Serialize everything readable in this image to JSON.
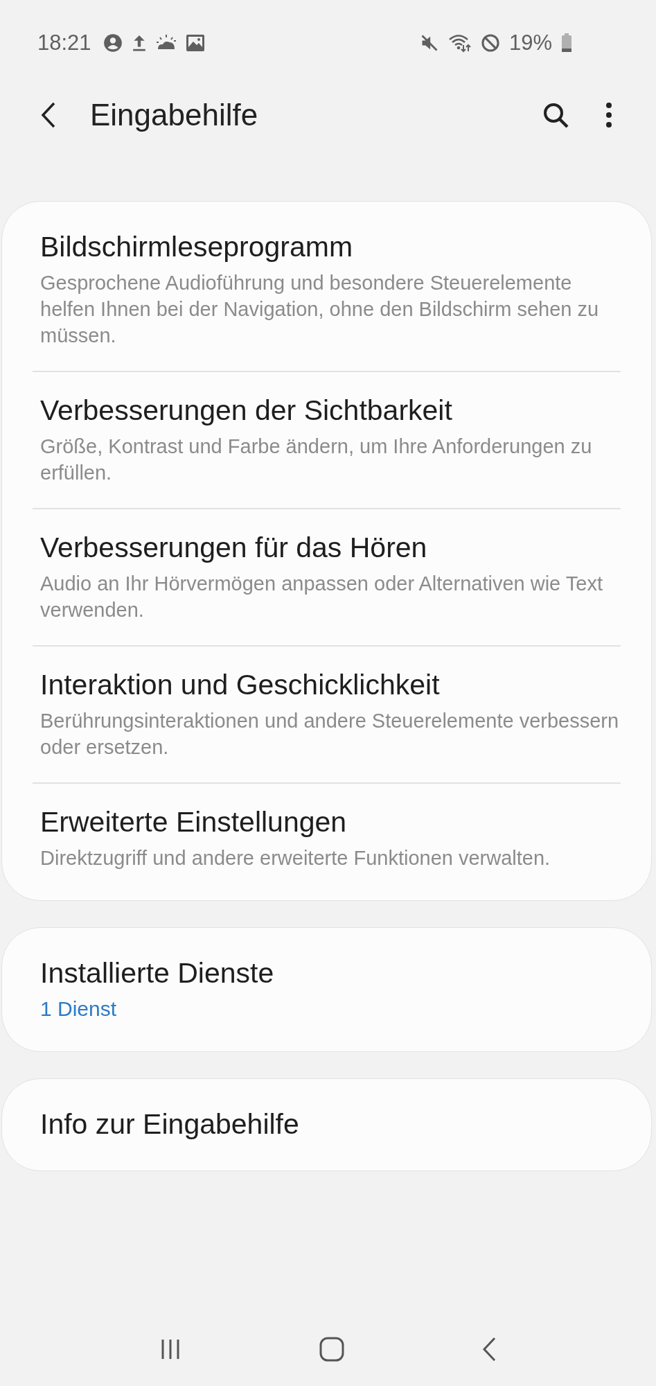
{
  "status_bar": {
    "time": "18:21",
    "battery": "19%"
  },
  "app_bar": {
    "title": "Eingabehilfe"
  },
  "groups": [
    {
      "items": [
        {
          "title": "Bildschirmleseprogramm",
          "description": "Gesprochene Audioführung und besondere Steuerelemente helfen Ihnen bei der Navigation, ohne den Bildschirm sehen zu müssen."
        },
        {
          "title": "Verbesserungen der Sichtbarkeit",
          "description": "Größe, Kontrast und Farbe ändern, um Ihre Anforderungen zu erfüllen."
        },
        {
          "title": "Verbesserungen für das Hören",
          "description": "Audio an Ihr Hörvermögen anpassen oder Alternativen wie Text verwenden."
        },
        {
          "title": "Interaktion und Geschicklichkeit",
          "description": "Berührungsinteraktionen und andere Steuerelemente verbessern oder ersetzen."
        },
        {
          "title": "Erweiterte Einstellungen",
          "description": "Direktzugriff und andere erweiterte Funktionen verwalten."
        }
      ]
    },
    {
      "items": [
        {
          "title": "Installierte Dienste",
          "value": "1 Dienst"
        }
      ]
    },
    {
      "items": [
        {
          "title": "Info zur Eingabehilfe"
        }
      ]
    }
  ]
}
